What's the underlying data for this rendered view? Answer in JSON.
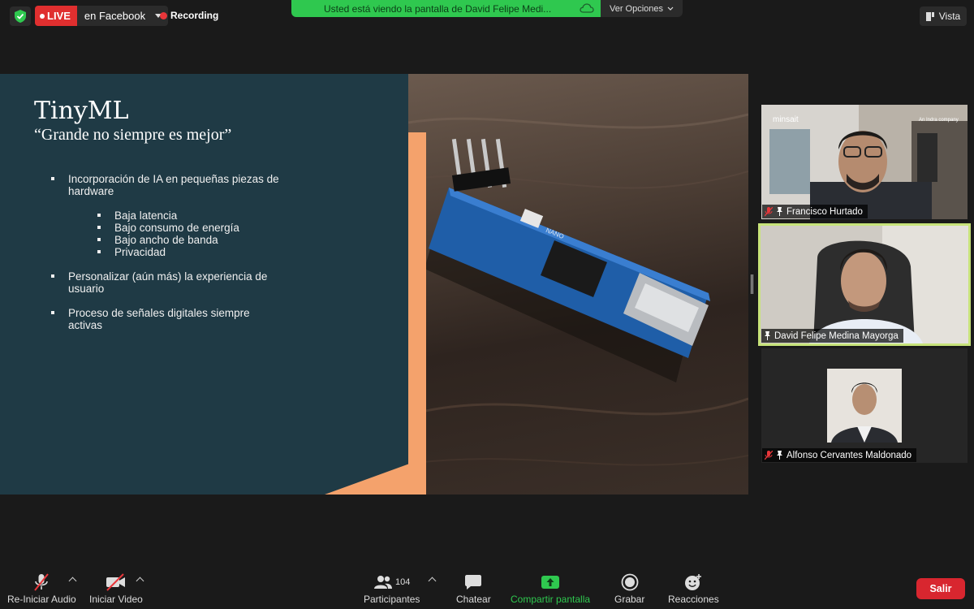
{
  "topbar": {
    "live_label": "LIVE",
    "live_destination": "en Facebook",
    "recording_label": "Recording",
    "share_banner": "Usted está viendo la pantalla de David Felipe Medi...",
    "options_label": "Ver Opciones",
    "view_label": "Vista"
  },
  "slide": {
    "title": "TinyML",
    "subtitle": "“Grande no siempre es mejor”",
    "bullet1": "Incorporación de IA  en pequeñas piezas de hardware",
    "sub_bullets": [
      "Baja latencia",
      "Bajo consumo de energía",
      "Bajo ancho de banda",
      "Privacidad"
    ],
    "bullet2": "Personalizar (aún más) la experiencia de usuario",
    "bullet3": "Proceso de señales digitales siempre activas",
    "board_label": "NANO",
    "photo_brand_left": "minsait",
    "photo_brand_right": "An Indra company"
  },
  "participants": [
    {
      "name": "Francisco Hurtado",
      "muted": true
    },
    {
      "name": "David Felipe Medina Mayorga",
      "muted": false,
      "active_speaker": true
    },
    {
      "name": "Alfonso Cervantes Maldonado",
      "muted": true
    }
  ],
  "toolbar": {
    "audio_label": "Re-Iniciar Audio",
    "video_label": "Iniciar Video",
    "participants_label": "Participantes",
    "participants_count": "104",
    "chat_label": "Chatear",
    "share_label": "Compartir pantalla",
    "record_label": "Grabar",
    "reactions_label": "Reacciones",
    "leave_label": "Salir"
  },
  "colors": {
    "share_green": "#2fc84f",
    "live_red": "#e02f2f",
    "leave_red": "#d8262f",
    "active_speaker_border": "#c7e37a",
    "slide_bg": "#1f3a45",
    "slide_accent": "#f4a26c"
  }
}
